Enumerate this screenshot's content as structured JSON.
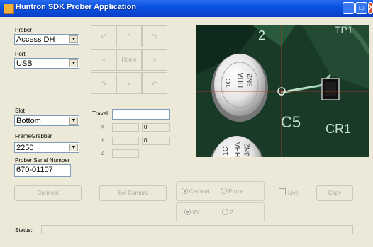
{
  "window": {
    "title": "Huntron SDK Prober Application",
    "min": "_",
    "max": "□",
    "close": "X"
  },
  "left_panel": {
    "prober_label": "Prober",
    "prober_value": "Access DH",
    "port_label": "Port",
    "port_value": "USB",
    "slot_label": "Slot",
    "slot_value": "Bottom",
    "framegrabber_label": "FrameGrabber",
    "framegrabber_value": "2250",
    "serial_label": "Prober Serial Number",
    "serial_value": "670-01107"
  },
  "jog": {
    "up_left": "<^",
    "up": "^",
    "up_right": "^>",
    "left": "<",
    "home": "Home",
    "right": ">",
    "down_left": "<v",
    "down": "v",
    "down_right": "v>"
  },
  "position": {
    "travel_label": "Travel",
    "travel_value": "",
    "x_label": "X",
    "x_value": "0",
    "y_label": "Y",
    "y_value": "0",
    "z_label": "Z"
  },
  "camera_view": {
    "labels": [
      "2",
      "TP1",
      "C5",
      "CR1",
      "1C",
      "HHA",
      "3N2",
      "1C",
      "HHA",
      "3N2"
    ],
    "colors": {
      "board": "#1a3a28",
      "crosshair": "#c0392b"
    }
  },
  "buttons": {
    "connect": "Connect",
    "set_camera": "Set Camera",
    "copy": "Copy"
  },
  "mode": {
    "camera": "Camera",
    "probe": "Probe",
    "xy": "XY",
    "z": "Z",
    "live": "Live"
  },
  "status": {
    "label": "Status:",
    "value": ""
  }
}
